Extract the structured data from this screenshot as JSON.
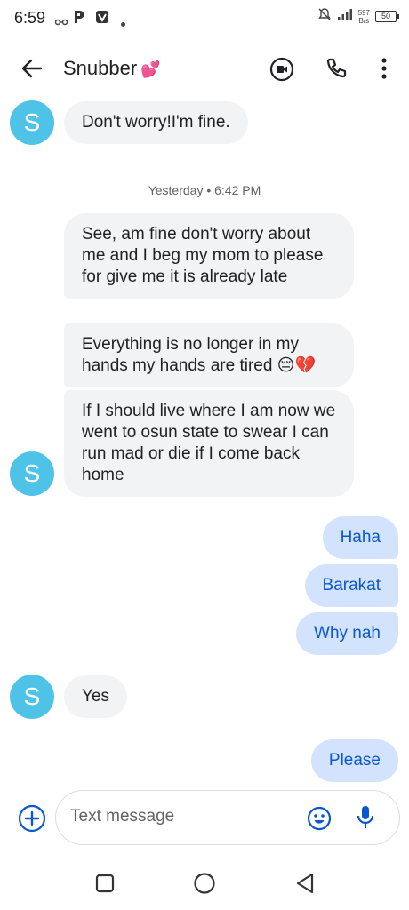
{
  "status_bar": {
    "time": "6:59",
    "net_speed_value": "597",
    "net_speed_unit": "B/s",
    "battery": "50",
    "icons": [
      "link-icon",
      "p-app-icon",
      "v-app-icon",
      "dot-icon",
      "mute-icon",
      "signal-icon",
      "battery-icon"
    ]
  },
  "header": {
    "contact_name": "Snubber",
    "title_emoji": "💕",
    "icons": [
      "back-arrow-icon",
      "video-call-icon",
      "phone-icon",
      "more-vert-icon"
    ]
  },
  "conversation": {
    "avatar_initial": "S",
    "avatar_color": "#4fc3e7",
    "incoming_bubble_color": "#f1f3f4",
    "outgoing_bubble_color": "#d3e3fd",
    "outgoing_text_color": "#0b57d0",
    "divider": "Yesterday • 6:42 PM",
    "messages": [
      {
        "direction": "incoming",
        "text": "Don't worry!I'm fine."
      },
      {
        "direction": "incoming",
        "text": "See, am fine don't worry about me and I beg my mom to please for give me it is already late"
      },
      {
        "direction": "incoming",
        "text": "Everything is no longer in my hands my hands are tired 😔💔"
      },
      {
        "direction": "incoming",
        "text": "If I should live where I am now we went to osun state to swear I can run mad or die if I come back home"
      },
      {
        "direction": "outgoing",
        "text": "Haha"
      },
      {
        "direction": "outgoing",
        "text": "Barakat"
      },
      {
        "direction": "outgoing",
        "text": "Why nah"
      },
      {
        "direction": "incoming",
        "text": "Yes"
      },
      {
        "direction": "outgoing",
        "text": "Please"
      }
    ]
  },
  "compose": {
    "placeholder": "Text message",
    "icons": [
      "add-circle-icon",
      "emoji-icon",
      "mic-icon"
    ]
  },
  "nav_bar": {
    "icons": [
      "recents-square-icon",
      "home-circle-icon",
      "back-triangle-icon"
    ]
  }
}
